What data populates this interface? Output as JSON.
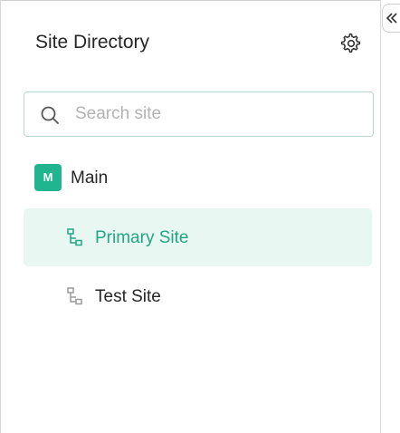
{
  "sidebar": {
    "title": "Site Directory",
    "search": {
      "placeholder": "Search site",
      "value": ""
    },
    "tree": {
      "root": {
        "badge": "M",
        "label": "Main"
      },
      "items": [
        {
          "label": "Primary Site",
          "selected": true
        },
        {
          "label": "Test Site",
          "selected": false
        }
      ]
    }
  },
  "icons": {
    "settings": "gear-icon",
    "search": "search-icon",
    "collapse": "collapse-left-icon",
    "site": "site-tree-icon"
  },
  "colors": {
    "accent": "#20b58f",
    "selected_bg": "#e9f7f3",
    "selected_text": "#22a583",
    "search_border": "#b9d7d0"
  }
}
